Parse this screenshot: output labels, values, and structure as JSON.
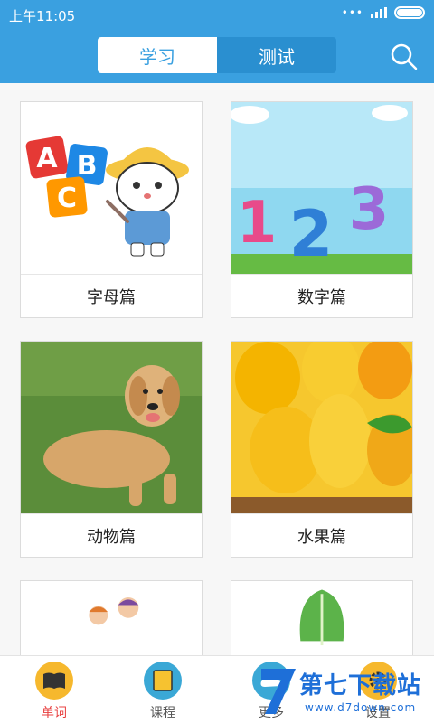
{
  "status": {
    "time": "上午11:05",
    "dots": "•••"
  },
  "header": {
    "tabs": [
      "学习",
      "测试"
    ]
  },
  "cards": [
    {
      "label": "字母篇",
      "letters": [
        "A",
        "B",
        "C"
      ]
    },
    {
      "label": "数字篇",
      "digits": [
        "1",
        "2",
        "3"
      ]
    },
    {
      "label": "动物篇"
    },
    {
      "label": "水果篇"
    }
  ],
  "tabbar": {
    "items": [
      "单词",
      "课程",
      "更多",
      "设置"
    ]
  },
  "watermark": {
    "title": "第七下载站",
    "url": "www.d7down.com"
  },
  "colors": {
    "primary": "#3aa0e0",
    "active_tab_text": "#e84040"
  }
}
